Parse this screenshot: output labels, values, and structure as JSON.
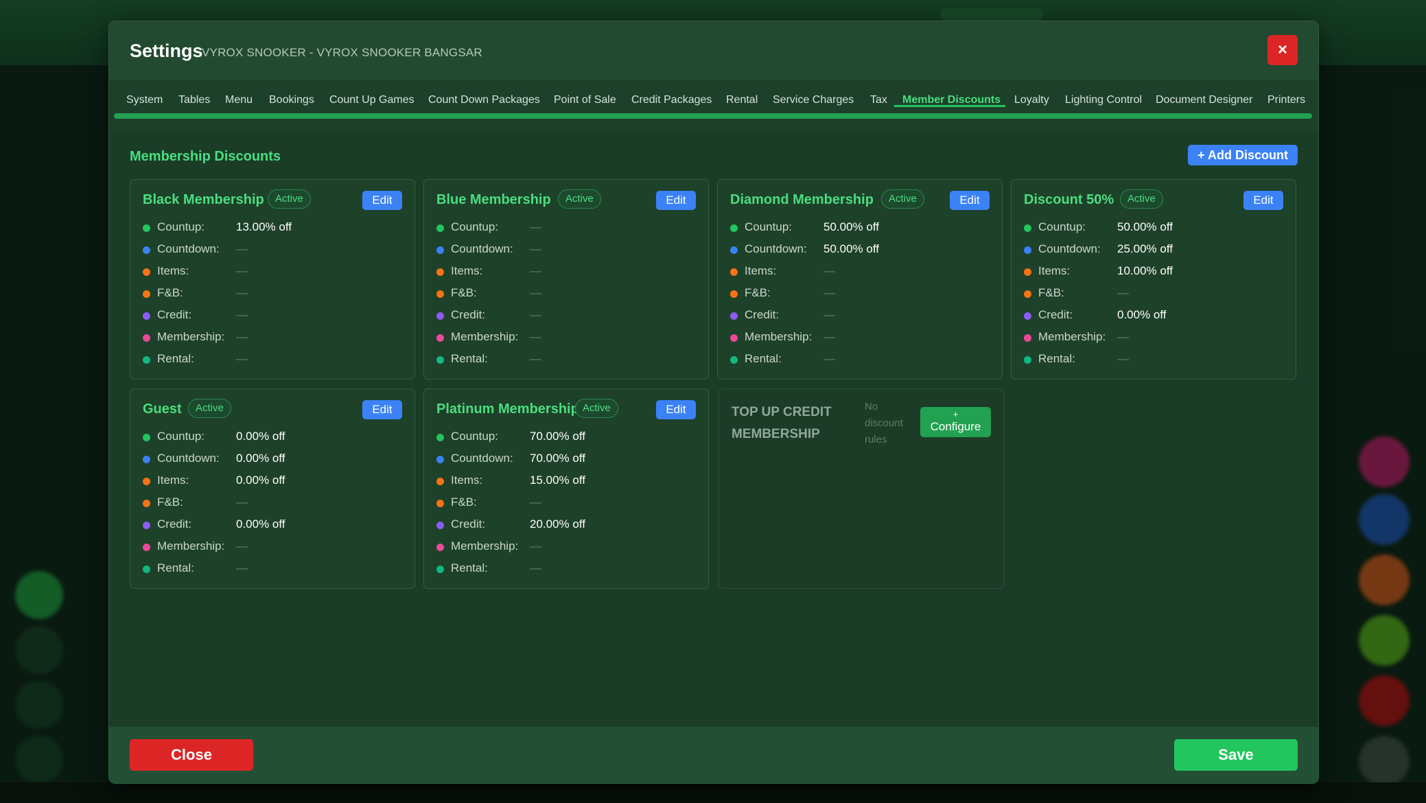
{
  "colors": {
    "accent_green": "#4ade80",
    "primary_blue": "#3b82f6",
    "danger_red": "#dc2626",
    "success_green": "#22c55e",
    "dot_countup": "#22c55e",
    "dot_countdown": "#3b82f6",
    "dot_items": "#f97316",
    "dot_fnb": "#f97316",
    "dot_credit": "#8b5cf6",
    "dot_membership": "#ec4899",
    "dot_rental": "#10b981"
  },
  "header": {
    "title": "Settings",
    "subtitle": "VYROX SNOOKER - VYROX SNOOKER BANGSAR",
    "close_icon": "×"
  },
  "tabs": [
    {
      "label": "System"
    },
    {
      "label": "Tables"
    },
    {
      "label": "Menu"
    },
    {
      "label": "Bookings"
    },
    {
      "label": "Count Up Games"
    },
    {
      "label": "Count Down Packages"
    },
    {
      "label": "Point of Sale"
    },
    {
      "label": "Credit Packages"
    },
    {
      "label": "Rental"
    },
    {
      "label": "Service Charges"
    },
    {
      "label": "Tax"
    },
    {
      "label": "Member Discounts",
      "active": true
    },
    {
      "label": "Loyalty"
    },
    {
      "label": "Lighting Control"
    },
    {
      "label": "Document Designer"
    },
    {
      "label": "Printers"
    }
  ],
  "section": {
    "title": "Membership Discounts",
    "add_label": "+ Add Discount"
  },
  "row_labels": {
    "countup": "Countup:",
    "countdown": "Countdown:",
    "items": "Items:",
    "fnb": "F&B:",
    "credit": "Credit:",
    "membership": "Membership:",
    "rental": "Rental:"
  },
  "cards": [
    {
      "name": "Black Membership",
      "status": "Active",
      "edit_label": "Edit",
      "countup": "13.00% off",
      "countdown": "—",
      "items": "—",
      "fnb": "—",
      "credit": "—",
      "membership": "—",
      "rental": "—"
    },
    {
      "name": "Blue Membership",
      "status": "Active",
      "edit_label": "Edit",
      "countup": "—",
      "countdown": "—",
      "items": "—",
      "fnb": "—",
      "credit": "—",
      "membership": "—",
      "rental": "—"
    },
    {
      "name": "Diamond Membership",
      "status": "Active",
      "edit_label": "Edit",
      "countup": "50.00% off",
      "countdown": "50.00% off",
      "items": "—",
      "fnb": "—",
      "credit": "—",
      "membership": "—",
      "rental": "—"
    },
    {
      "name": "Discount 50%",
      "status": "Active",
      "edit_label": "Edit",
      "countup": "50.00% off",
      "countdown": "25.00% off",
      "items": "10.00% off",
      "fnb": "—",
      "credit": "0.00% off",
      "membership": "—",
      "rental": "—"
    },
    {
      "name": "Guest",
      "status": "Active",
      "edit_label": "Edit",
      "countup": "0.00% off",
      "countdown": "0.00% off",
      "items": "0.00% off",
      "fnb": "—",
      "credit": "0.00% off",
      "membership": "—",
      "rental": "—"
    },
    {
      "name": "Platinum Membership",
      "status": "Active",
      "edit_label": "Edit",
      "countup": "70.00% off",
      "countdown": "70.00% off",
      "items": "15.00% off",
      "fnb": "—",
      "credit": "20.00% off",
      "membership": "—",
      "rental": "—"
    }
  ],
  "unconfigured": {
    "name": "TOP UP CREDIT MEMBERSHIP",
    "note": "No discount rules",
    "configure_plus": "+",
    "configure_label": "Configure"
  },
  "footer": {
    "close_label": "Close",
    "save_label": "Save"
  }
}
